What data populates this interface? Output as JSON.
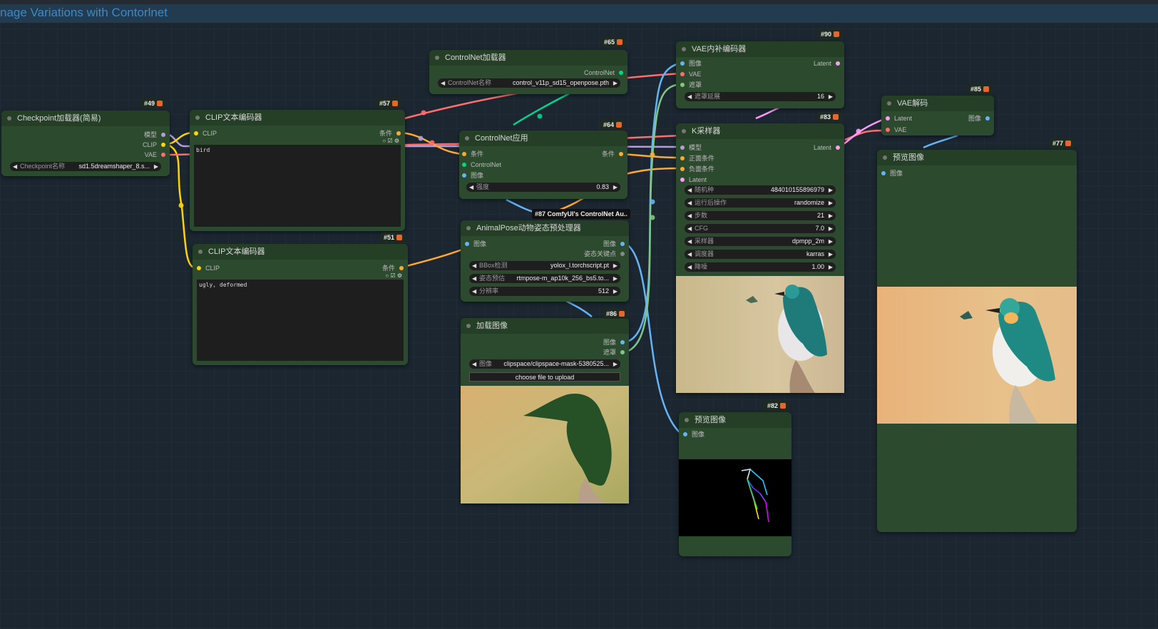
{
  "group": {
    "title": "nage Variations with Contorlnet"
  },
  "colors": {
    "clip": "#ffd500",
    "model": "#b39ddb",
    "vae": "#ff6e6e",
    "cond": "#ffa931",
    "image": "#64b5f6",
    "latent": "#ff9cf9",
    "mask": "#81c784",
    "controlnet": "#00d78d",
    "pose": "#888888"
  },
  "nodes": {
    "ckpt": {
      "id": "#49",
      "title": "Checkpoint加载器(简易)",
      "outputs": [
        "模型",
        "CLIP",
        "VAE"
      ],
      "widget_label": "Checkpoint名称",
      "widget_value": "sd1.5dreamshaper_8.s..."
    },
    "clip57": {
      "id": "#57",
      "title": "CLIP文本编码器",
      "input": "CLIP",
      "output": "条件",
      "text": "bird"
    },
    "clip51": {
      "id": "#51",
      "title": "CLIP文本编码器",
      "input": "CLIP",
      "output": "条件",
      "text": "ugly, deformed"
    },
    "cnload": {
      "id": "#65",
      "title": "ControlNet加载器",
      "output": "ControlNet",
      "widget_label": "ControlNet名称",
      "widget_value": "control_v11p_sd15_openpose.pth"
    },
    "cnapply": {
      "id": "#64",
      "title": "ControlNet应用",
      "inputs": [
        "条件",
        "ControlNet",
        "图像"
      ],
      "output": "条件",
      "widget_label": "强度",
      "widget_value": "0.83"
    },
    "animal": {
      "id": "#87 ComfyUI's ControlNet Au..",
      "title": "AnimalPose动物姿态预处理器",
      "input": "图像",
      "outputs": [
        "图像",
        "姿态关键点"
      ],
      "widgets": [
        {
          "label": "BBox检测",
          "value": "yolox_l.torchscript.pt"
        },
        {
          "label": "姿态预估",
          "value": "rtmpose-m_ap10k_256_bs5.to..."
        },
        {
          "label": "分辨率",
          "value": "512"
        }
      ]
    },
    "loadimg": {
      "id": "#86",
      "title": "加载图像",
      "outputs": [
        "图像",
        "遮罩"
      ],
      "widget_label": "图像",
      "widget_value": "clipspace/clipspace-mask-5380525...",
      "button": "choose file to upload"
    },
    "vaeinp": {
      "id": "#90",
      "title": "VAE内补编码器",
      "inputs": [
        "图像",
        "VAE",
        "遮罩"
      ],
      "output": "Latent",
      "widget_label": "遮罩延展",
      "widget_value": "16"
    },
    "ksampler": {
      "id": "#83",
      "title": "K采样器",
      "inputs": [
        "模型",
        "正面条件",
        "负面条件",
        "Latent"
      ],
      "output": "Latent",
      "widgets": [
        {
          "label": "随机种",
          "value": "484010155896979"
        },
        {
          "label": "运行后操作",
          "value": "randomize"
        },
        {
          "label": "步数",
          "value": "21"
        },
        {
          "label": "CFG",
          "value": "7.0"
        },
        {
          "label": "采样器",
          "value": "dpmpp_2m"
        },
        {
          "label": "调度器",
          "value": "karras"
        },
        {
          "label": "降噪",
          "value": "1.00"
        }
      ]
    },
    "vaedec": {
      "id": "#85",
      "title": "VAE解码",
      "inputs": [
        "Latent",
        "VAE"
      ],
      "output": "图像"
    },
    "prev77": {
      "id": "#77",
      "title": "预览图像",
      "input": "图像"
    },
    "prev82": {
      "id": "#82",
      "title": "预览图像",
      "input": "图像"
    }
  }
}
